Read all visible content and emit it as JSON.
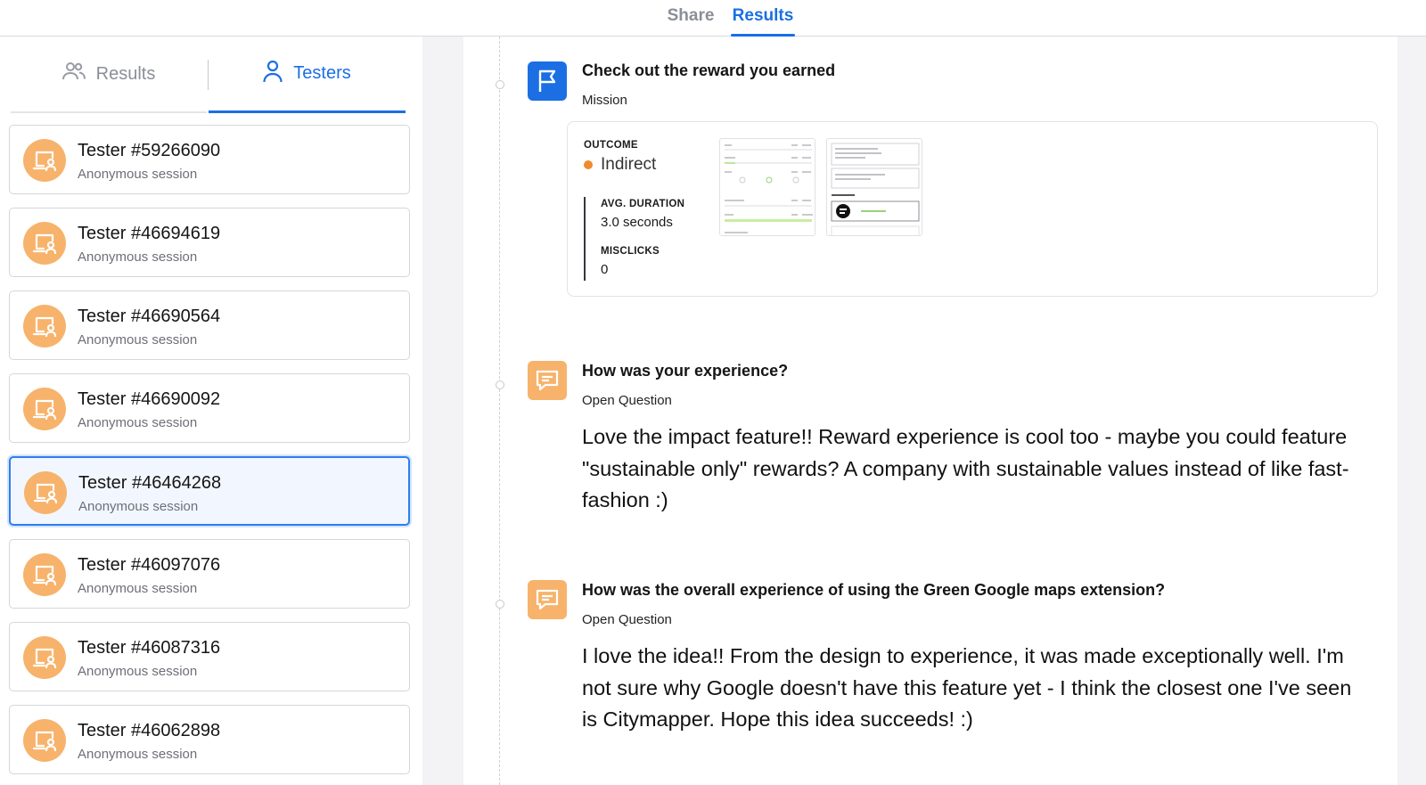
{
  "top_tabs": {
    "share": "Share",
    "results": "Results"
  },
  "sidebar": {
    "tabs": {
      "results": "Results",
      "testers": "Testers"
    },
    "testers": [
      {
        "name": "Tester #59266090",
        "session": "Anonymous session"
      },
      {
        "name": "Tester #46694619",
        "session": "Anonymous session"
      },
      {
        "name": "Tester #46690564",
        "session": "Anonymous session"
      },
      {
        "name": "Tester #46690092",
        "session": "Anonymous session"
      },
      {
        "name": "Tester #46464268",
        "session": "Anonymous session",
        "selected": true
      },
      {
        "name": "Tester #46097076",
        "session": "Anonymous session"
      },
      {
        "name": "Tester #46087316",
        "session": "Anonymous session"
      },
      {
        "name": "Tester #46062898",
        "session": "Anonymous session"
      }
    ]
  },
  "blocks": {
    "mission": {
      "title": "Check out the reward you earned",
      "type": "Mission",
      "outcome_label": "OUTCOME",
      "outcome_value": "Indirect",
      "duration_label": "AVG. DURATION",
      "duration_value": "3.0 seconds",
      "misclicks_label": "MISCLICKS",
      "misclicks_value": "0"
    },
    "q1": {
      "title": "How was your experience?",
      "type": "Open Question",
      "answer": "Love the impact feature!! Reward experience is cool too - maybe you could feature \"sustainable only\" rewards? A company with sustainable values instead of like fast-fashion :)"
    },
    "q2": {
      "title": "How was the overall experience of using the Green Google maps extension?",
      "type": "Open Question",
      "answer": "I love the idea!! From the design to experience, it was made exceptionally well. I'm not sure why Google doesn't have this feature yet - I think the closest one I've seen is Citymapper. Hope this idea succeeds! :)"
    }
  },
  "colors": {
    "accent": "#1b6fe3",
    "avatar": "#f7b36b",
    "outcome_indirect": "#f08a2c"
  },
  "icons": {
    "results_tab": "users-icon",
    "testers_tab": "user-icon",
    "avatar": "laptop-user-icon",
    "mission": "flag-icon",
    "question": "chat-bubble-icon"
  }
}
